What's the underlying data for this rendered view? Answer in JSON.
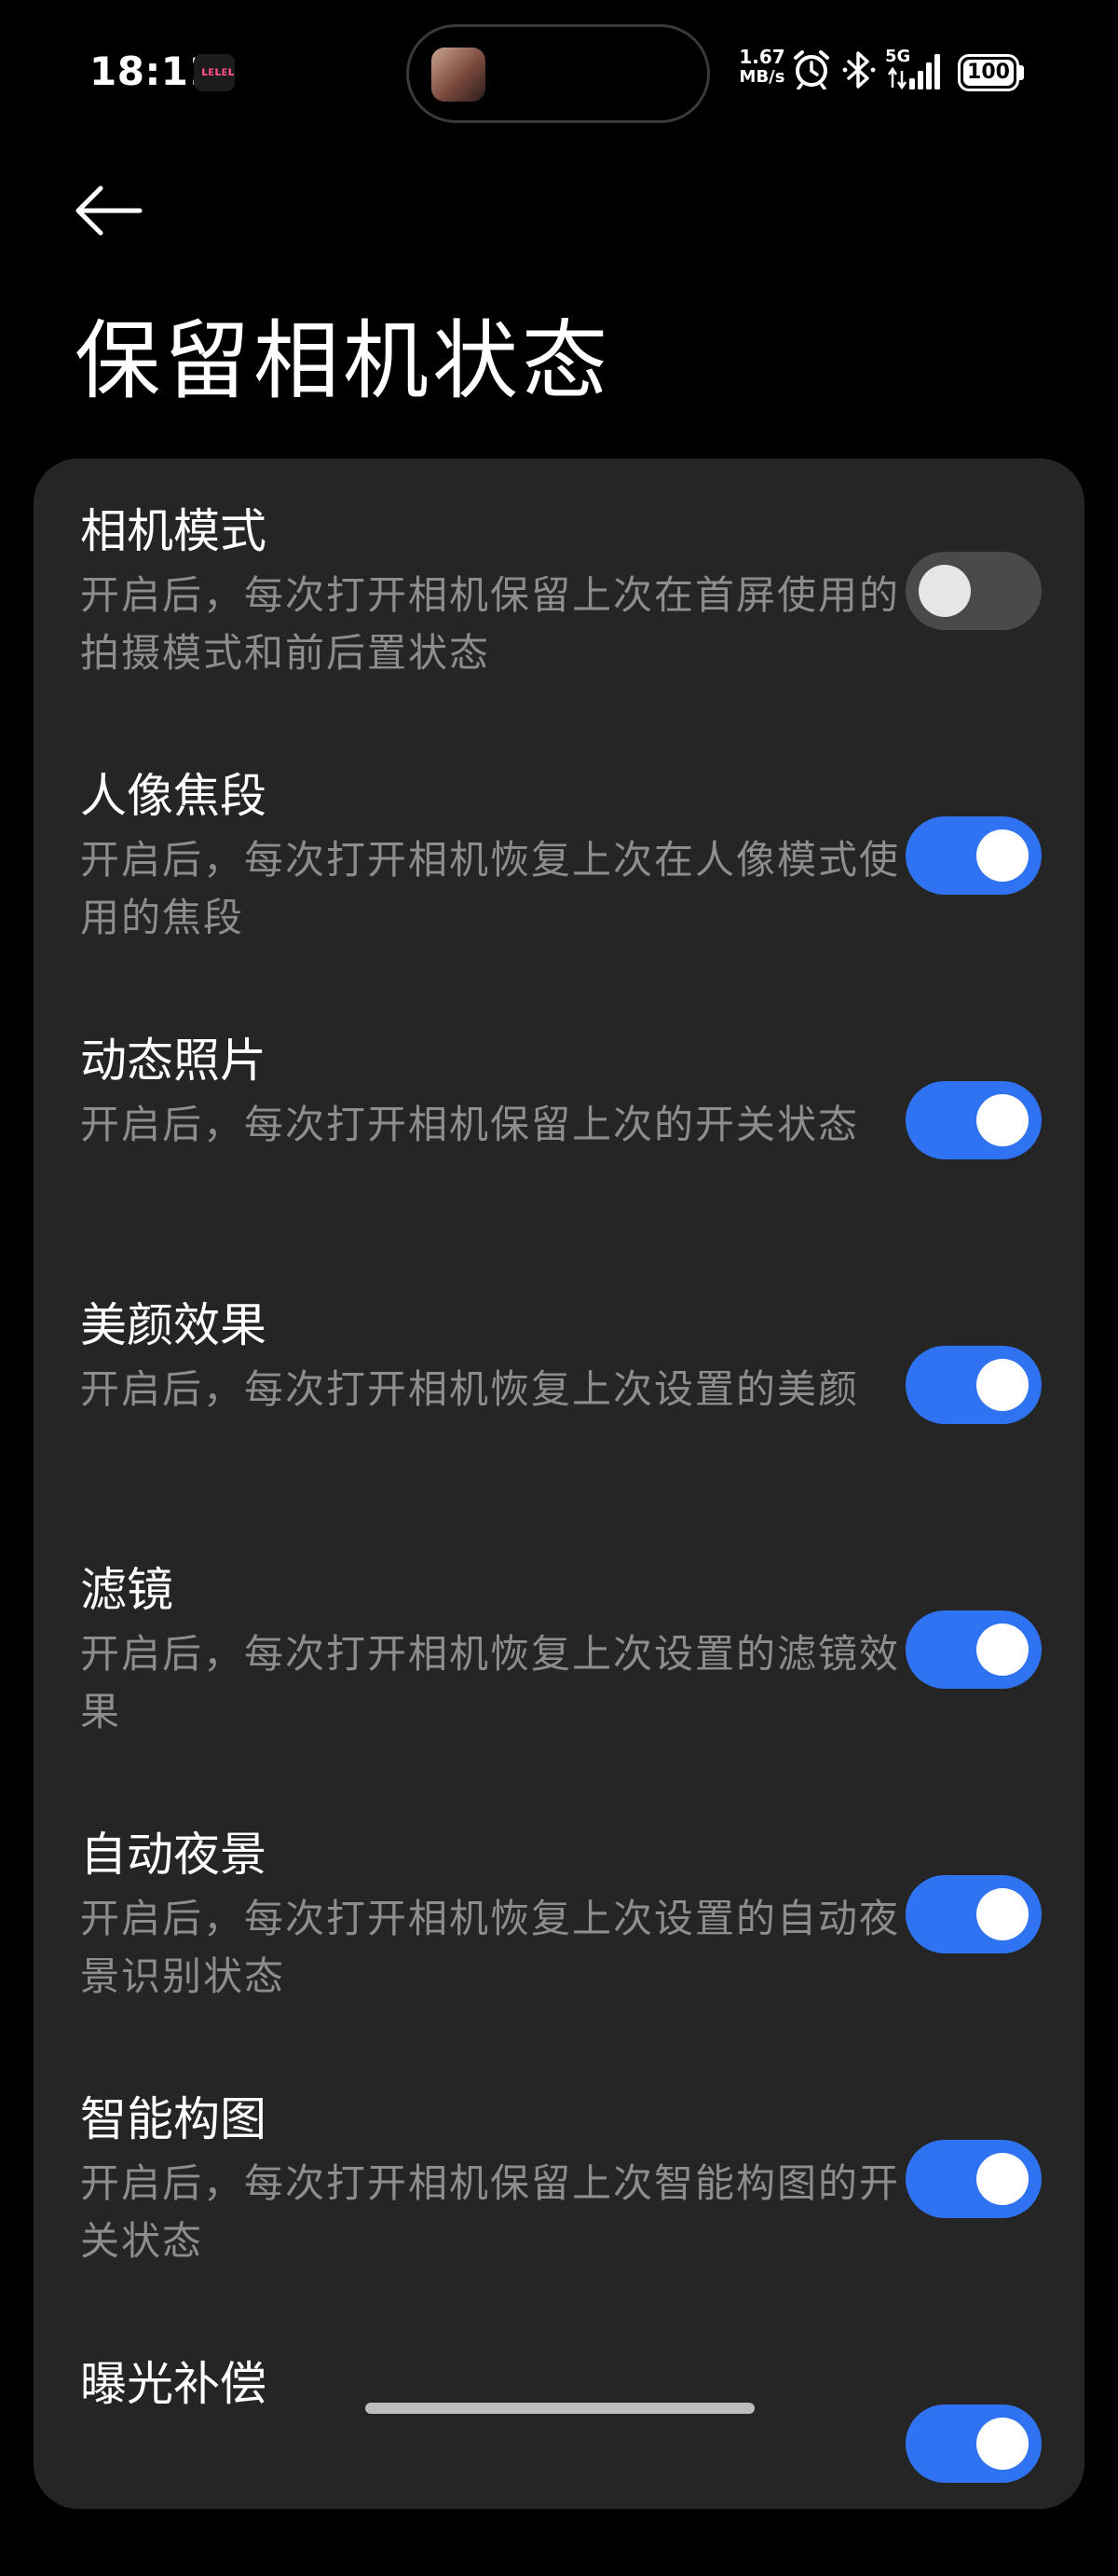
{
  "status_bar": {
    "time": "18:11",
    "app_badge_text": "ʟᴇʟᴇʟ",
    "net_speed_value": "1.67",
    "net_speed_unit": "MB/s",
    "network_type": "5G",
    "battery": "100",
    "icons": [
      "alarm-icon",
      "bluetooth-icon",
      "signal-icon",
      "battery-icon"
    ]
  },
  "header": {
    "back_icon": "back-arrow-icon",
    "title": "保留相机状态"
  },
  "settings": [
    {
      "title": "相机模式",
      "desc": "开启后，每次打开相机保留上次在首屏使用的拍摄模式和前后置状态",
      "enabled": false
    },
    {
      "title": "人像焦段",
      "desc": "开启后，每次打开相机恢复上次在人像模式使用的焦段",
      "enabled": true
    },
    {
      "title": "动态照片",
      "desc": "开启后，每次打开相机保留上次的开关状态",
      "enabled": true
    },
    {
      "title": "美颜效果",
      "desc": "开启后，每次打开相机恢复上次设置的美颜",
      "enabled": true
    },
    {
      "title": "滤镜",
      "desc": "开启后，每次打开相机恢复上次设置的滤镜效果",
      "enabled": true
    },
    {
      "title": "自动夜景",
      "desc": "开启后，每次打开相机恢复上次设置的自动夜景识别状态",
      "enabled": true
    },
    {
      "title": "智能构图",
      "desc": "开启后，每次打开相机保留上次智能构图的开关状态",
      "enabled": true
    },
    {
      "title": "曝光补偿",
      "desc": "",
      "enabled": true
    }
  ],
  "colors": {
    "accent": "#2f73f2",
    "card": "#252525",
    "background": "#000000",
    "secondary_text": "#8d8d8d"
  }
}
